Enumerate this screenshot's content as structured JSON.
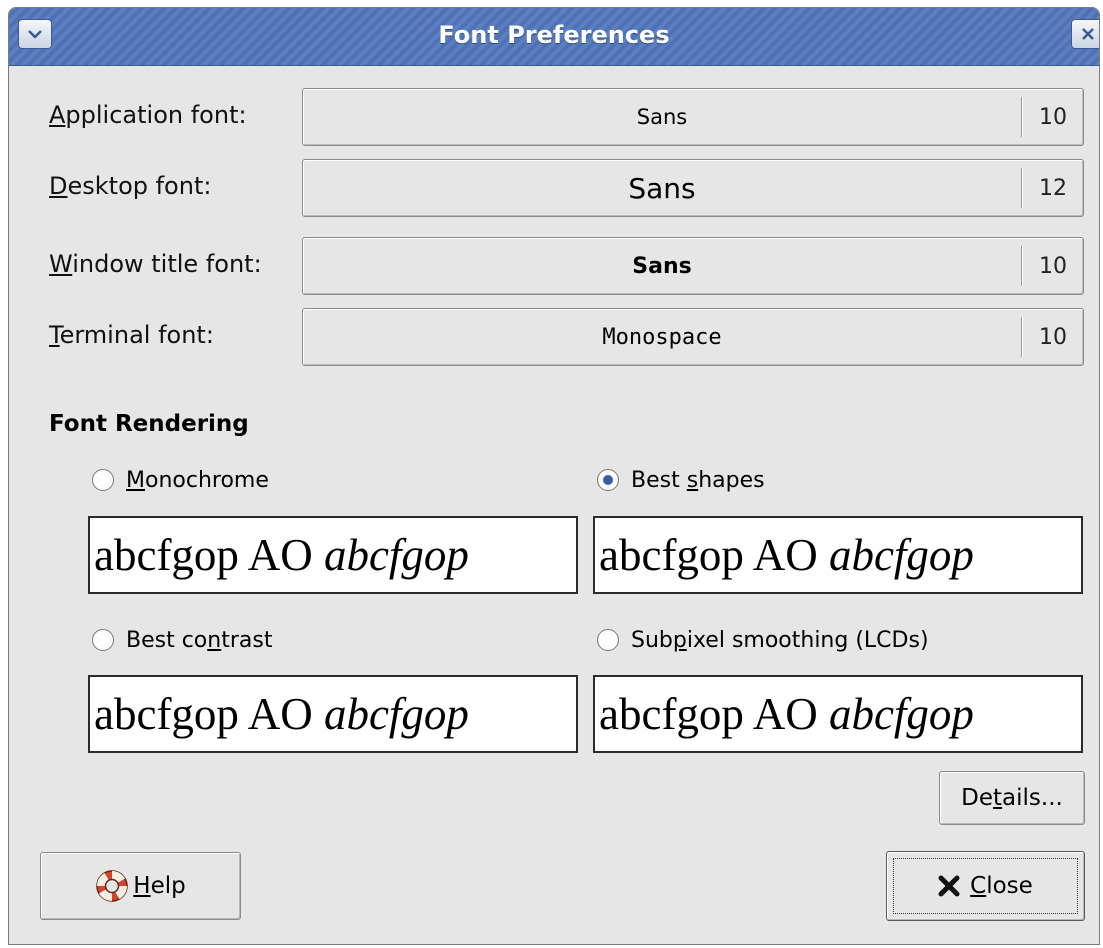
{
  "window": {
    "title": "Font Preferences"
  },
  "fonts": [
    {
      "label_accel": "A",
      "label_rest": "pplication font:",
      "name": "Sans",
      "size": "10"
    },
    {
      "label_accel": "D",
      "label_rest": "esktop font:",
      "name": "Sans",
      "size": "12"
    },
    {
      "label_accel": "W",
      "label_rest": "indow title font:",
      "name": "Sans",
      "size": "10"
    },
    {
      "label_accel": "T",
      "label_rest": "erminal font:",
      "name": "Monospace",
      "size": "10"
    }
  ],
  "rendering": {
    "title": "Font Rendering",
    "options": [
      {
        "pre": "",
        "accel": "M",
        "post": "onochrome",
        "selected": false
      },
      {
        "pre": "Best ",
        "accel": "s",
        "post": "hapes",
        "selected": true
      },
      {
        "pre": "Best co",
        "accel": "n",
        "post": "trast",
        "selected": false
      },
      {
        "pre": "Sub",
        "accel": "p",
        "post": "ixel smoothing (LCDs)",
        "selected": false
      }
    ],
    "sample_plain": "abcfgop AO ",
    "sample_italic": "abcfgop"
  },
  "buttons": {
    "details": {
      "pre": "De",
      "accel": "t",
      "post": "ails..."
    },
    "help": {
      "accel": "H",
      "post": "elp"
    },
    "close": {
      "accel": "C",
      "post": "lose"
    }
  },
  "icons": {
    "window_menu": "chevron-down-icon",
    "window_close": "close-icon",
    "help": "lifebuoy-icon",
    "close": "x-mark-icon"
  }
}
